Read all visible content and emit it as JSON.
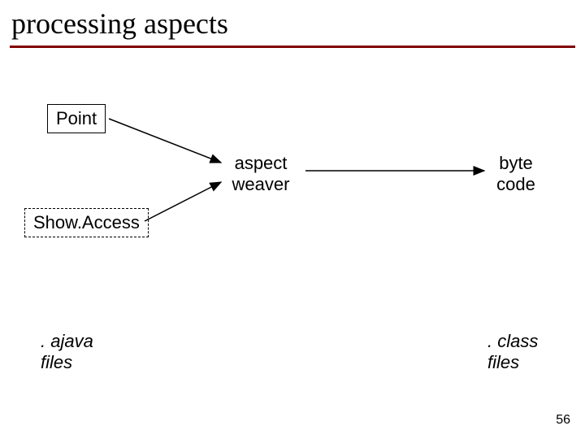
{
  "title": "processing aspects",
  "boxes": {
    "point": "Point",
    "showaccess": "Show.Access"
  },
  "labels": {
    "weaver_line1": "aspect",
    "weaver_line2": "weaver",
    "bytecode_line1": "byte",
    "bytecode_line2": "code",
    "ajava_line1": ". ajava",
    "ajava_line2": "files",
    "class_line1": ". class",
    "class_line2": "files"
  },
  "page_number": "56"
}
